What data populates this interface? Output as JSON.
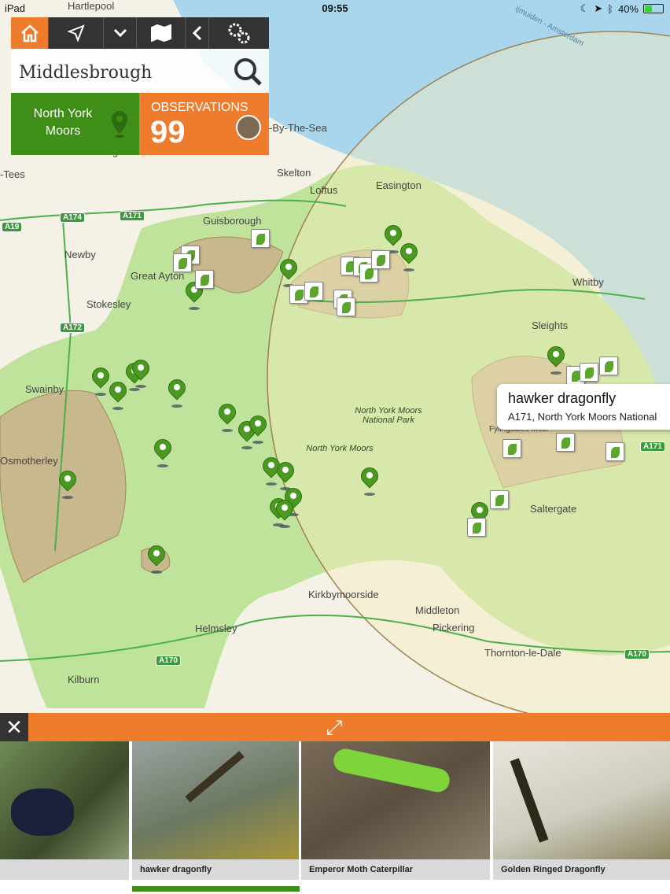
{
  "status": {
    "device": "iPad",
    "time": "09:55",
    "battery": "40%",
    "battery_level": 0.4
  },
  "toolbar": {
    "icons": [
      "home-icon",
      "locate-arrow-icon",
      "chevron-down-icon",
      "map-icon",
      "chevron-left-icon",
      "settings-gears-icon"
    ]
  },
  "search": {
    "value": "Middlesbrough"
  },
  "park": {
    "name": "North York Moors"
  },
  "observations": {
    "label": "OBSERVATIONS",
    "count": "99"
  },
  "callout": {
    "title": "hawker dragonfly",
    "subtitle": "A171, North York Moors National"
  },
  "map": {
    "places": [
      "Hartlepool",
      "Middlesbrough",
      "-Tees",
      "Skelton",
      "Loftus",
      "Easington",
      "Guisborough",
      "Newby",
      "Great Ayton",
      "Stokesley",
      "Whitby",
      "Sleights",
      "Swainby",
      "Osmotherley",
      "Saltergate",
      "Kirkbymoorside",
      "Middleton",
      "Pickering",
      "Helmsley",
      "Thornton-le-Dale",
      "Kilburn",
      "-By-The-Sea",
      "Fylingdales Moor"
    ],
    "roads": [
      "A19",
      "A174",
      "A171",
      "A172",
      "A170",
      "A170",
      "A171"
    ],
    "park_labels": [
      "North York Moors National Park",
      "North York Moors"
    ],
    "sea_route": "Ijmuiden - Amsterdam"
  },
  "bottom": {
    "close": "✕",
    "expand": "⤢"
  },
  "photos": [
    {
      "caption": "",
      "desc": "beetle"
    },
    {
      "caption": "hawker dragonfly",
      "desc": "dragonfly"
    },
    {
      "caption": "Emperor Moth Caterpillar",
      "desc": "caterpillar"
    },
    {
      "caption": "Golden Ringed Dragonfly",
      "desc": "dragonfly"
    }
  ],
  "colors": {
    "accent": "#ef7c2d",
    "park_green": "#3e8e18",
    "toolbar": "#333333"
  }
}
